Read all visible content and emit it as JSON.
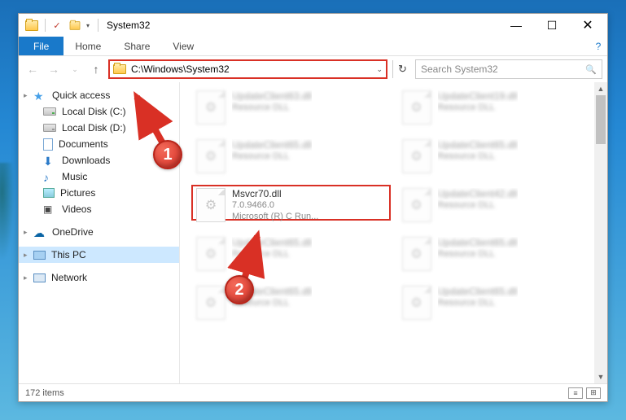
{
  "window": {
    "title": "System32",
    "min_glyph": "—",
    "max_glyph": "☐",
    "close_glyph": "✕"
  },
  "ribbon": {
    "file": "File",
    "home": "Home",
    "share": "Share",
    "view": "View",
    "help_glyph": "?"
  },
  "nav": {
    "back_glyph": "←",
    "fwd_glyph": "→",
    "up_glyph": "↑",
    "refresh_glyph": "↻",
    "address": "C:\\Windows\\System32",
    "address_drop": "⌄",
    "search_placeholder": "Search System32",
    "search_glyph": "🔍"
  },
  "sidebar": {
    "groups": [
      {
        "top": true,
        "icon": "star",
        "label": "Quick access",
        "chev": true
      },
      {
        "icon": "drive",
        "label": "Local Disk (C:)"
      },
      {
        "icon": "drive-d",
        "label": "Local Disk (D:)"
      },
      {
        "icon": "document",
        "label": "Documents"
      },
      {
        "icon": "download",
        "label": "Downloads"
      },
      {
        "icon": "music",
        "label": "Music"
      },
      {
        "icon": "pictures",
        "label": "Pictures"
      },
      {
        "icon": "videos",
        "label": "Videos"
      },
      {
        "spacer": true
      },
      {
        "top": true,
        "icon": "onedrive",
        "label": "OneDrive",
        "chev": true
      },
      {
        "spacer": true
      },
      {
        "top": true,
        "icon": "thispc",
        "label": "This PC",
        "chev": true,
        "sel": true
      },
      {
        "spacer": true
      },
      {
        "top": true,
        "icon": "network",
        "label": "Network",
        "chev": true
      }
    ]
  },
  "files": [
    {
      "name": "UpdateClient63.dll",
      "sub1": "Resource DLL",
      "sub2": "",
      "blur": true
    },
    {
      "name": "UpdateClient19.dll",
      "sub1": "Resource DLL",
      "sub2": "",
      "blur": true
    },
    {
      "name": "UpdateClient65.dll",
      "sub1": "Resource DLL",
      "sub2": "",
      "blur": true
    },
    {
      "name": "UpdateClient65.dll",
      "sub1": "Resource DLL",
      "sub2": "",
      "blur": true
    },
    {
      "name": "Msvcr70.dll",
      "sub1": "7.0.9466.0",
      "sub2": "Microsoft (R) C Run...",
      "blur": false,
      "highlight": true
    },
    {
      "name": "UpdateClient42.dll",
      "sub1": "Resource DLL",
      "sub2": "",
      "blur": true
    },
    {
      "name": "UpdateClient65.dll",
      "sub1": "Resource DLL",
      "sub2": "",
      "blur": true
    },
    {
      "name": "UpdateClient65.dll",
      "sub1": "Resource DLL",
      "sub2": "",
      "blur": true
    },
    {
      "name": "UpdateClient65.dll",
      "sub1": "Resource DLL",
      "sub2": "",
      "blur": true
    },
    {
      "name": "UpdateClient65.dll",
      "sub1": "Resource DLL",
      "sub2": "",
      "blur": true
    }
  ],
  "status": {
    "count": "172 items"
  },
  "callouts": {
    "one": "1",
    "two": "2"
  }
}
